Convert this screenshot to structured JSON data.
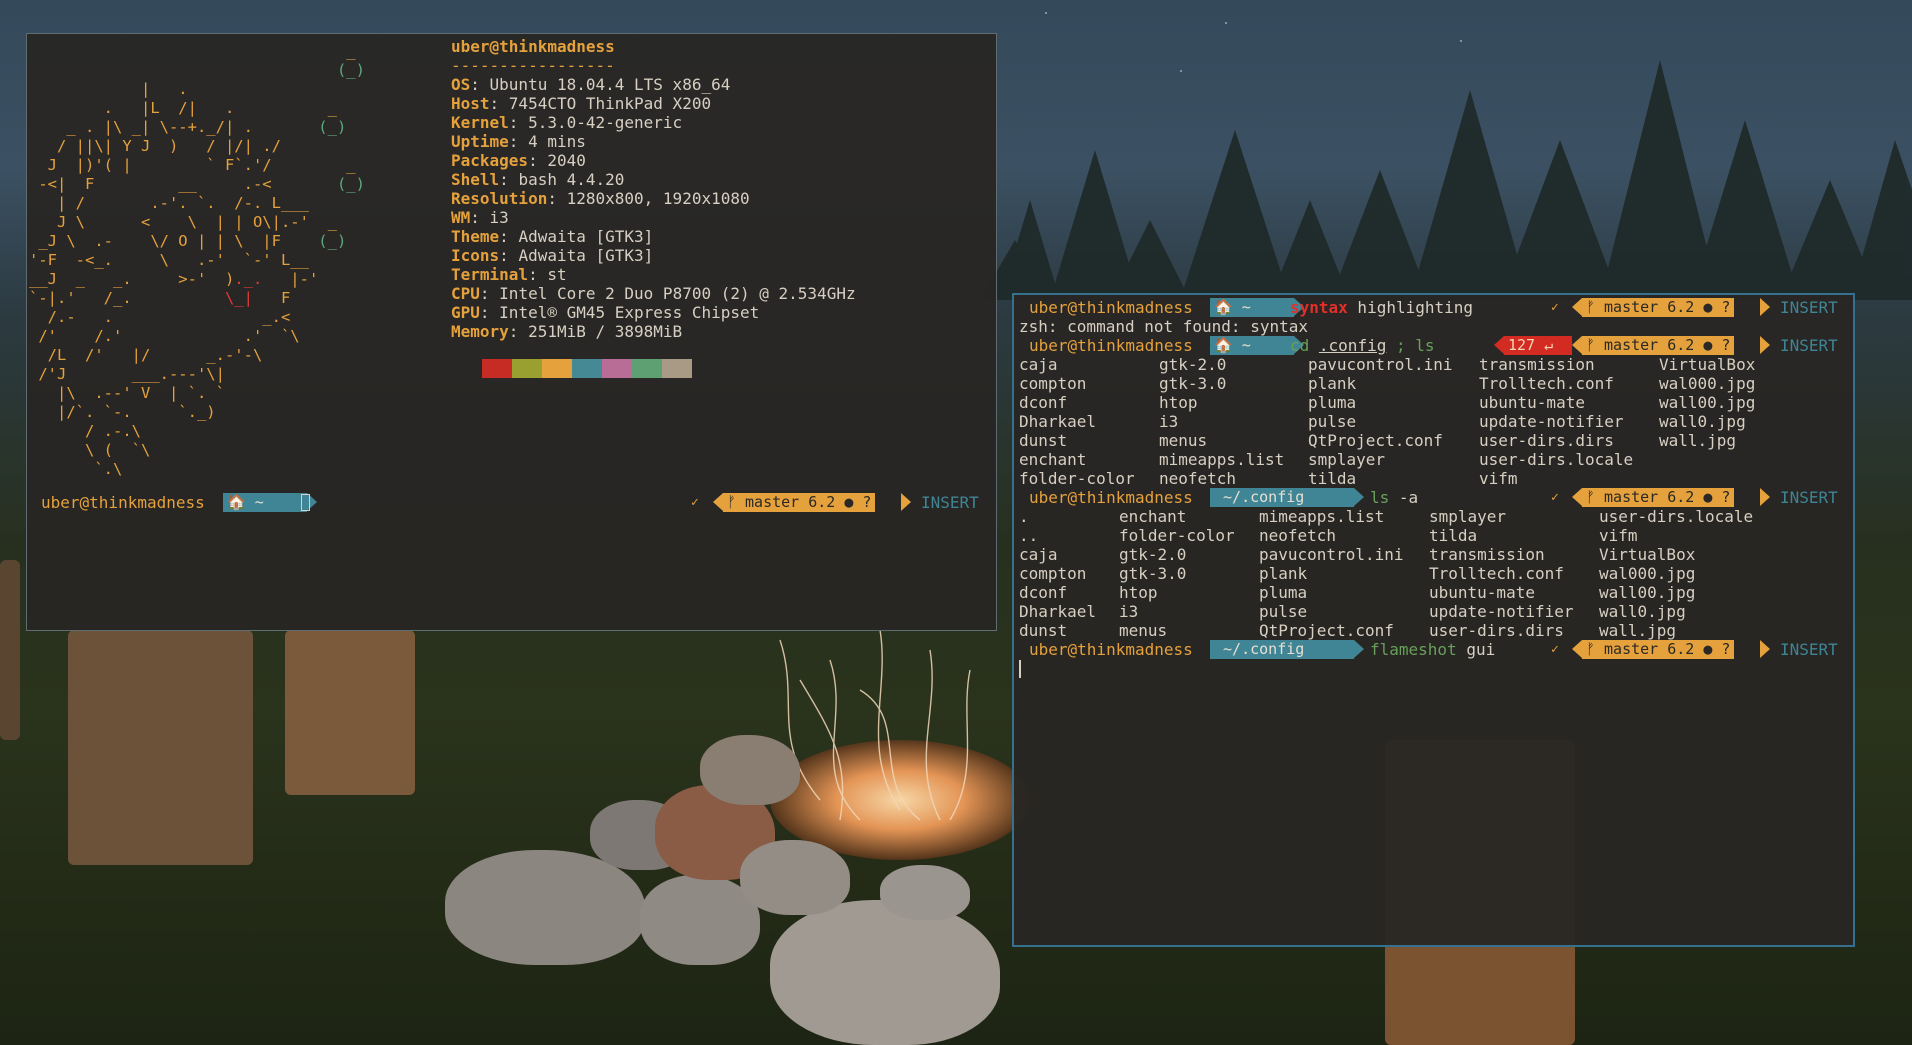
{
  "neofetch": {
    "title": "uber@thinkmadness",
    "separator": "-----------------",
    "rows": [
      {
        "key": "OS",
        "value": "Ubuntu 18.04.4 LTS x86_64"
      },
      {
        "key": "Host",
        "value": "7454CTO ThinkPad X200"
      },
      {
        "key": "Kernel",
        "value": "5.3.0-42-generic"
      },
      {
        "key": "Uptime",
        "value": "4 mins"
      },
      {
        "key": "Packages",
        "value": "2040"
      },
      {
        "key": "Shell",
        "value": "bash 4.4.20"
      },
      {
        "key": "Resolution",
        "value": "1280x800, 1920x1080"
      },
      {
        "key": "WM",
        "value": "i3"
      },
      {
        "key": "Theme",
        "value": "Adwaita [GTK3]"
      },
      {
        "key": "Icons",
        "value": "Adwaita [GTK3]"
      },
      {
        "key": "Terminal",
        "value": "st"
      },
      {
        "key": "CPU",
        "value": "Intel Core 2 Duo P8700 (2) @ 2.534GHz"
      },
      {
        "key": "GPU",
        "value": "Intel® GM45 Express Chipset"
      },
      {
        "key": "Memory",
        "value": "251MiB / 3898MiB"
      }
    ],
    "palette": [
      "#c62b24",
      "#9aa02f",
      "#e5a13c",
      "#448994",
      "#b86d96",
      "#5fa072",
      "#a99a86"
    ]
  },
  "prompt": {
    "user": "uber@thinkmadness",
    "home": "🏠 ~",
    "config_dir": " ~/.config",
    "git": "ᚠ master 6.2 ● ?",
    "mode": "INSERT",
    "check": "✓",
    "error": "127 ↵"
  },
  "right": {
    "cmd1_a": "syntax",
    "cmd1_b": " highlighting",
    "err_line": "zsh: command not found: syntax",
    "cmd2_cd": "cd",
    "cmd2_arg": ".config",
    "cmd2_rest": " ; ls",
    "ls_cols": [
      "caja\ncompton\ndconf\nDharkael\ndunst\nenchant\nfolder-color",
      "gtk-2.0\ngtk-3.0\nhtop\ni3\nmenus\nmimeapps.list\nneofetch",
      "pavucontrol.ini\nplank\npluma\npulse\nQtProject.conf\nsmplayer\ntilda",
      "transmission\nTrolltech.conf\nubuntu-mate\nupdate-notifier\nuser-dirs.dirs\nuser-dirs.locale\nvifm",
      "VirtualBox\nwal000.jpg\nwall00.jpg\nwall0.jpg\nwall.jpg"
    ],
    "cmd3_ls": "ls",
    "cmd3_rest": " -a",
    "lsa_cols": [
      ".\n..\ncaja\ncompton\ndconf\nDharkael\ndunst",
      "enchant\nfolder-color\ngtk-2.0\ngtk-3.0\nhtop\ni3\nmenus",
      "mimeapps.list\nneofetch\npavucontrol.ini\nplank\npluma\npulse\nQtProject.conf",
      "smplayer\ntilda\ntransmission\nTrolltech.conf\nubuntu-mate\nupdate-notifier\nuser-dirs.dirs",
      "user-dirs.locale\nvifm\nVirtualBox\nwal000.jpg\nwall00.jpg\nwall0.jpg\nwall.jpg"
    ],
    "cmd4_a": "flameshot",
    "cmd4_b": " gui"
  }
}
